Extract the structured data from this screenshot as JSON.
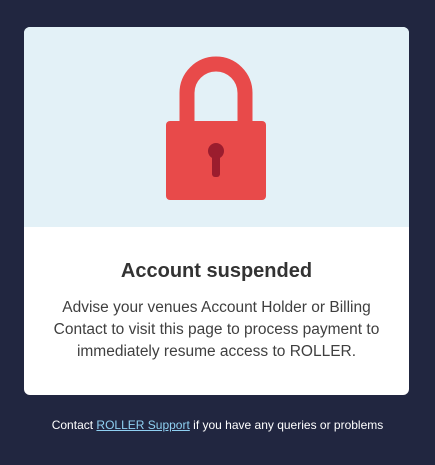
{
  "card": {
    "title": "Account suspended",
    "message": "Advise your venues Account Holder or Billing Contact to visit this page to process payment to immediately resume access to ROLLER.",
    "lock_icon": "lock-icon"
  },
  "footer": {
    "prefix": "Contact",
    "link_label": "ROLLER Support",
    "suffix": "if you have any queries or problems"
  },
  "colors": {
    "background": "#212640",
    "hero": "#e3f1f7",
    "lock": "#e84a4a",
    "link": "#8fd0f2"
  }
}
